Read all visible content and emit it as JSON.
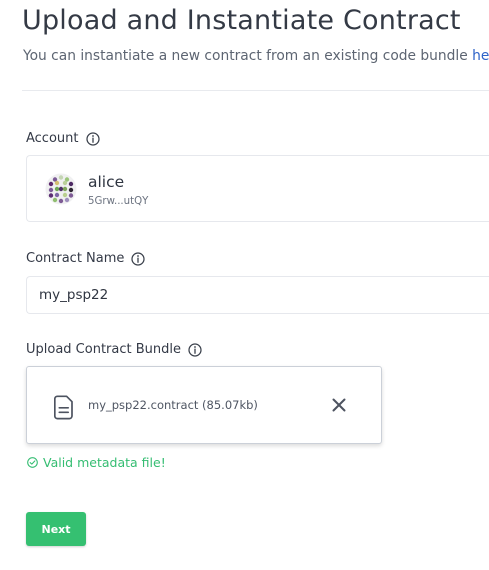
{
  "header": {
    "title": "Upload and Instantiate Contract",
    "subtitle_prefix": "You can instantiate a new contract from an existing code bundle ",
    "subtitle_link": "here",
    "subtitle_suffix": "."
  },
  "account": {
    "label": "Account",
    "info_icon": "info-icon",
    "selected": {
      "name": "alice",
      "address": "5Grw...utQY",
      "avatar_icon": "identicon-avatar"
    }
  },
  "contract_name": {
    "label": "Contract Name",
    "value": "my_psp22",
    "placeholder": ""
  },
  "upload": {
    "label": "Upload Contract Bundle",
    "file_icon": "document-icon",
    "file_name": "my_psp22.contract (85.07kb)",
    "remove_icon": "close-icon"
  },
  "validation": {
    "icon": "check-circle-icon",
    "message": "Valid metadata file!",
    "color": "#35bd72"
  },
  "actions": {
    "next_label": "Next",
    "next_color": "#35c071"
  },
  "colors": {
    "link": "#2d62c8",
    "text": "#2f3541",
    "border": "#e6e8ed"
  }
}
